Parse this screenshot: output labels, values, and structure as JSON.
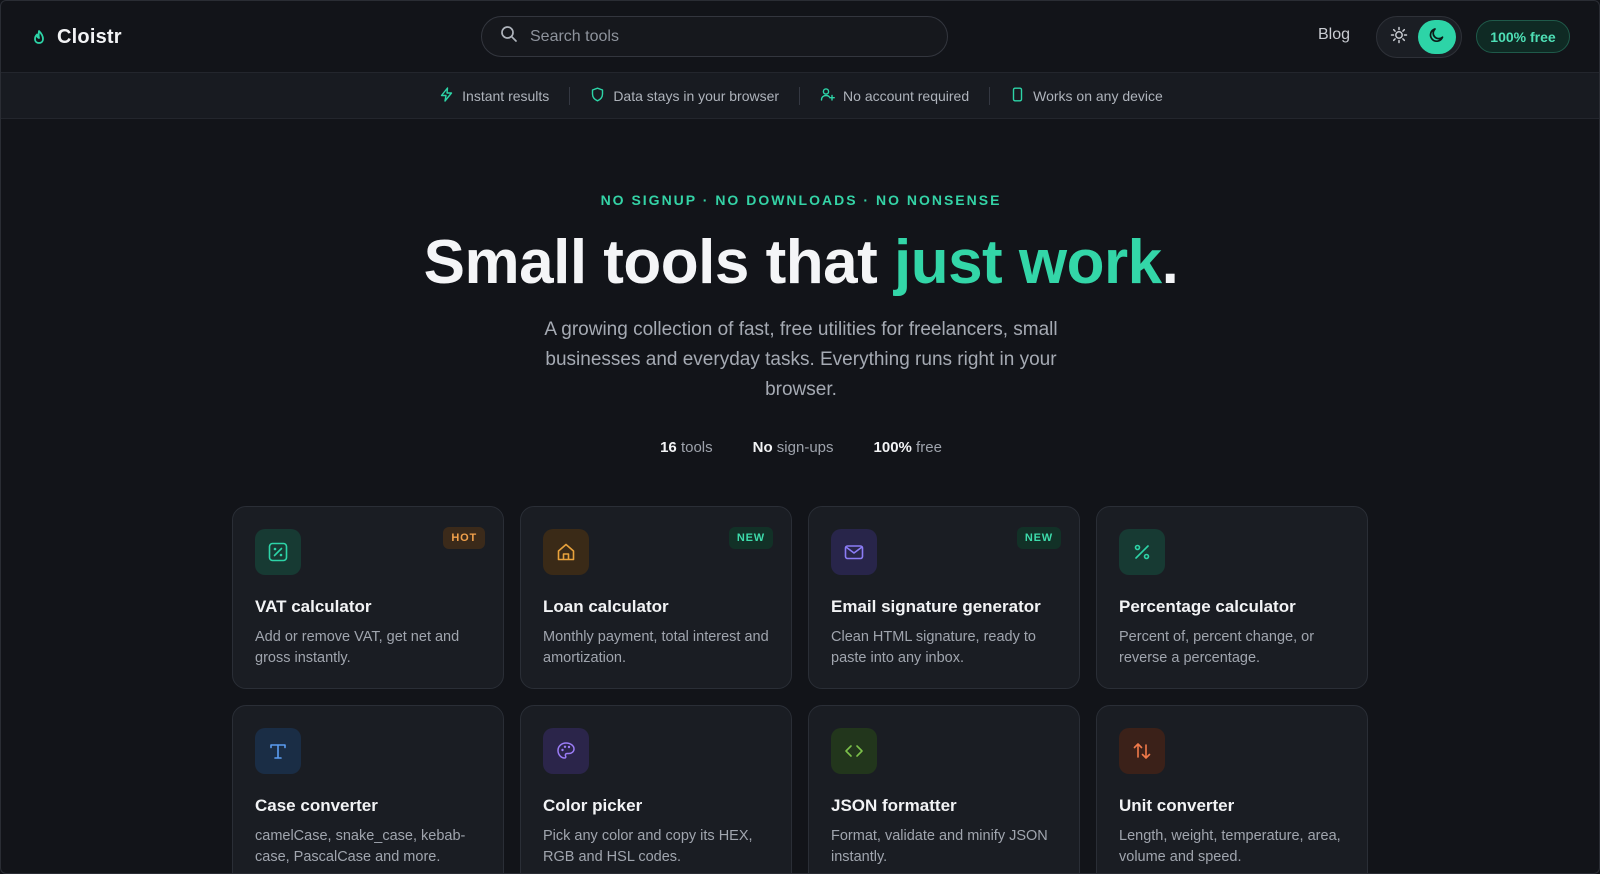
{
  "brand": {
    "name": "Cloistr",
    "accent": "#2dd4a7"
  },
  "header": {
    "search_placeholder": "Search tools",
    "blog_label": "Blog",
    "theme": {
      "light_icon": "sun-icon",
      "dark_icon": "moon-icon",
      "active": "dark"
    },
    "free_badge": "100% free"
  },
  "features": [
    {
      "icon": "bolt-icon",
      "label": "Instant results"
    },
    {
      "icon": "shield-icon",
      "label": "Data stays in your browser"
    },
    {
      "icon": "user-plus-icon",
      "label": "No account required"
    },
    {
      "icon": "phone-icon",
      "label": "Works on any device"
    }
  ],
  "hero": {
    "eyebrow": "NO SIGNUP · NO DOWNLOADS · NO NONSENSE",
    "headline_start": "Small tools that ",
    "headline_accent": "just work",
    "headline_end": ".",
    "subtitle": "A growing collection of fast, free utilities for freelancers, small businesses and everyday tasks. Everything runs right in your browser.",
    "stats": [
      {
        "strong": "16",
        "rest": " tools"
      },
      {
        "strong": "No",
        "rest": " sign-ups"
      },
      {
        "strong": "100%",
        "rest": " free"
      }
    ]
  },
  "tools": [
    {
      "title": "VAT calculator",
      "desc": "Add or remove VAT, get net and gross instantly.",
      "icon": "percent-box-icon",
      "badge": "HOT",
      "color": "#2dd4a7"
    },
    {
      "title": "Loan calculator",
      "desc": "Monthly payment, total interest and amortization.",
      "icon": "house-icon",
      "badge": "NEW",
      "color": "#e8a23c"
    },
    {
      "title": "Email signature generator",
      "desc": "Clean HTML signature, ready to paste into any inbox.",
      "icon": "mail-icon",
      "badge": "NEW",
      "color": "#8b7cf6"
    },
    {
      "title": "Percentage calculator",
      "desc": "Percent of, percent change, or reverse a percentage.",
      "icon": "percent-icon",
      "badge": "",
      "color": "#2dd4a7"
    },
    {
      "title": "Case converter",
      "desc": "camelCase, snake_case, kebab-case, PascalCase and more.",
      "icon": "type-icon",
      "badge": "",
      "color": "#5b9cf0"
    },
    {
      "title": "Color picker",
      "desc": "Pick any color and copy its HEX, RGB and HSL codes.",
      "icon": "palette-icon",
      "badge": "",
      "color": "#9b7cf6"
    },
    {
      "title": "JSON formatter",
      "desc": "Format, validate and minify JSON instantly.",
      "icon": "code-icon",
      "badge": "",
      "color": "#7cc04a"
    },
    {
      "title": "Unit converter",
      "desc": "Length, weight, temperature, area, volume and speed.",
      "icon": "swap-icon",
      "badge": "",
      "color": "#f07a4a"
    }
  ]
}
